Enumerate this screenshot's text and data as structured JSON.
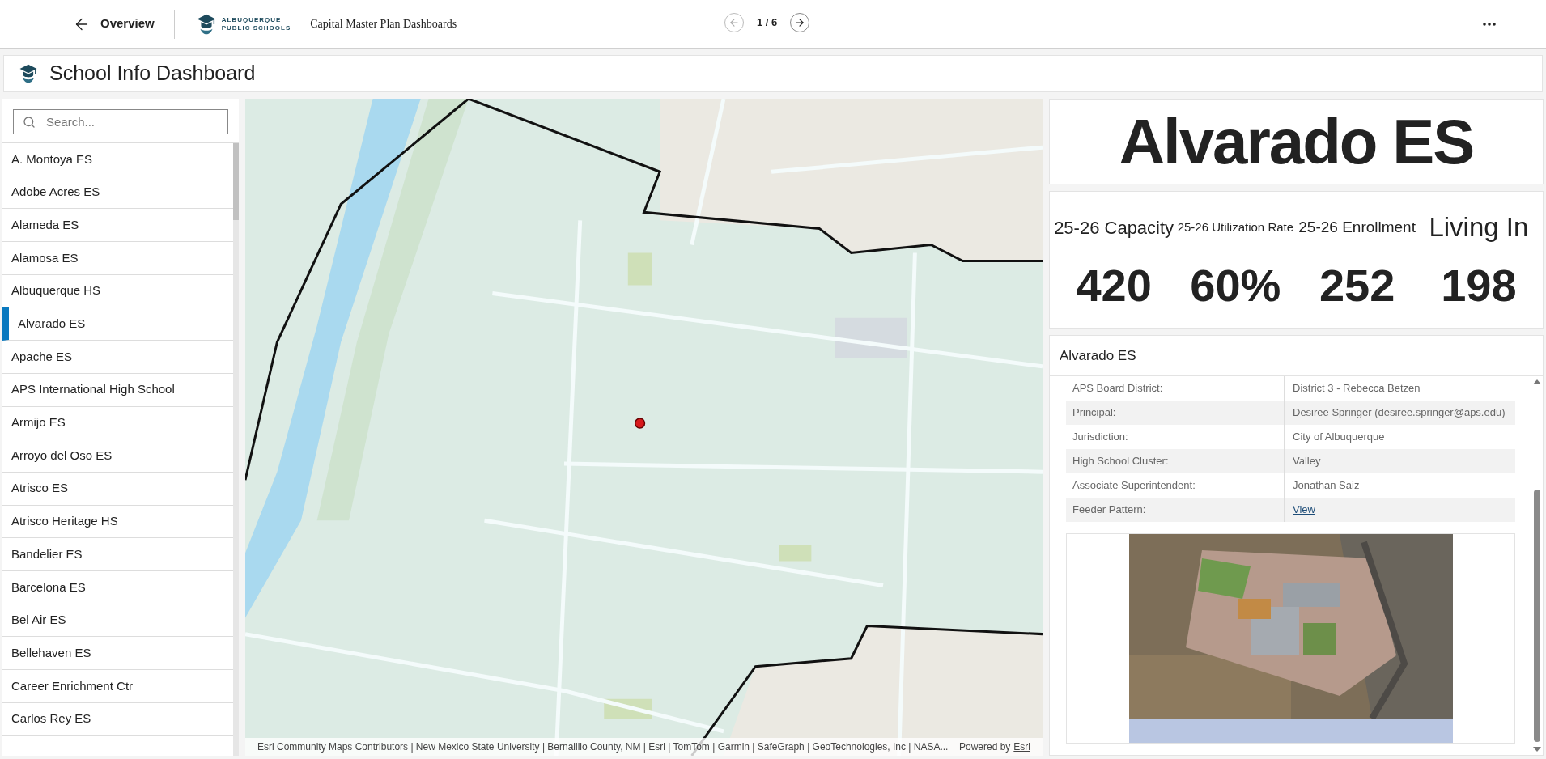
{
  "header": {
    "back_label": "Overview",
    "logo_lines": [
      "ALBUQUERQUE",
      "PUBLIC SCHOOLS"
    ],
    "app_title": "Capital Master Plan Dashboards",
    "pager": "1 / 6"
  },
  "dashboard": {
    "title": "School Info Dashboard"
  },
  "sidebar": {
    "search": {
      "placeholder": "Search..."
    },
    "items": [
      {
        "label": "A. Montoya ES",
        "selected": false
      },
      {
        "label": "Adobe Acres ES",
        "selected": false
      },
      {
        "label": "Alameda ES",
        "selected": false
      },
      {
        "label": "Alamosa ES",
        "selected": false
      },
      {
        "label": "Albuquerque HS",
        "selected": false
      },
      {
        "label": "Alvarado ES",
        "selected": true
      },
      {
        "label": "Apache ES",
        "selected": false
      },
      {
        "label": "APS International High School",
        "selected": false
      },
      {
        "label": "Armijo ES",
        "selected": false
      },
      {
        "label": "Arroyo del Oso ES",
        "selected": false
      },
      {
        "label": "Atrisco ES",
        "selected": false
      },
      {
        "label": "Atrisco Heritage HS",
        "selected": false
      },
      {
        "label": "Bandelier ES",
        "selected": false
      },
      {
        "label": "Barcelona ES",
        "selected": false
      },
      {
        "label": "Bel Air ES",
        "selected": false
      },
      {
        "label": "Bellehaven ES",
        "selected": false
      },
      {
        "label": "Career Enrichment Ctr",
        "selected": false
      },
      {
        "label": "Carlos Rey ES",
        "selected": false
      }
    ]
  },
  "map": {
    "attribution": "Esri Community Maps Contributors | New Mexico State University | Bernalillo County, NM | Esri | TomTom | Garmin | SafeGraph | GeoTechnologies, Inc | NASA...",
    "powered_by": "Powered by",
    "powered_link": "Esri"
  },
  "school": {
    "name": "Alvarado ES"
  },
  "stats": [
    {
      "label": "25-26 Capacity",
      "value": "420"
    },
    {
      "label": "25-26 Utilization Rate",
      "value": "60%"
    },
    {
      "label": "25-26 Enrollment",
      "value": "252"
    },
    {
      "label": "Living In",
      "value": "198"
    }
  ],
  "details": {
    "title": "Alvarado ES",
    "rows": [
      {
        "label": "APS Board District:",
        "value": "District 3 - Rebecca Betzen",
        "kind": "text"
      },
      {
        "label": "Principal:",
        "value": "Desiree Springer (desiree.springer@aps.edu)",
        "kind": "text"
      },
      {
        "label": "Jurisdiction:",
        "value": "City of Albuquerque",
        "kind": "text"
      },
      {
        "label": "High School Cluster:",
        "value": "Valley",
        "kind": "text"
      },
      {
        "label": "Associate Superintendent:",
        "value": "Jonathan Saiz",
        "kind": "text"
      },
      {
        "label": "Feeder Pattern:",
        "value": "View",
        "kind": "link"
      }
    ]
  }
}
